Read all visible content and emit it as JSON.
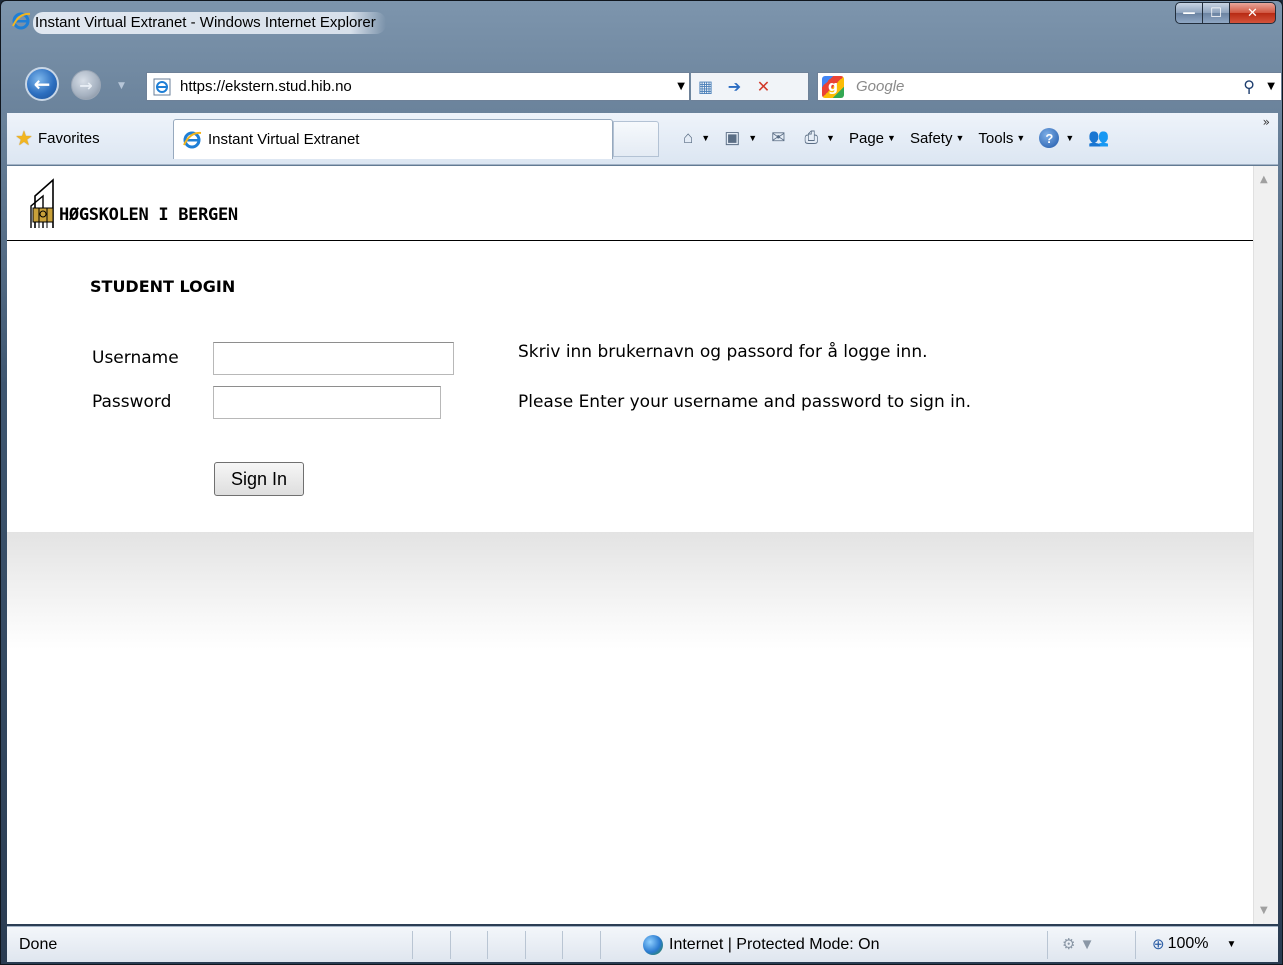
{
  "window": {
    "title": "Instant Virtual Extranet - Windows Internet Explorer",
    "controls": {
      "minimize": "—",
      "maximize": "☐",
      "close": "✕"
    }
  },
  "nav": {
    "back_glyph": "←",
    "forward_glyph": "→",
    "url": "https://ekstern.stud.hib.no",
    "search_placeholder": "Google",
    "search_logo_letter": "g"
  },
  "commandbar": {
    "favorites_label": "Favorites",
    "tab_label": "Instant Virtual Extranet",
    "page_label": "Page",
    "safety_label": "Safety",
    "tools_label": "Tools",
    "help_glyph": "?"
  },
  "page": {
    "logo_text": "HØGSKOLEN I BERGEN",
    "login_title": "STUDENT LOGIN",
    "username_label": "Username",
    "password_label": "Password",
    "username_value": "",
    "password_value": "",
    "msg_no": "Skriv inn brukernavn og passord for å logge inn.",
    "msg_en": "Please Enter your username and password to sign in.",
    "signin_label": "Sign In"
  },
  "status": {
    "text": "Done",
    "zone": "Internet | Protected Mode: On",
    "zoom": "100%"
  },
  "colors": {
    "frame": "#3e5670",
    "command_bar": "#dce6f2",
    "close_button": "#c0391f"
  },
  "icons": [
    "ie-icon",
    "back-icon",
    "forward-icon",
    "page-icon",
    "compat-icon",
    "go-icon",
    "stop-icon",
    "google-icon",
    "search-icon",
    "favorites-star-icon",
    "home-icon",
    "feeds-icon",
    "mail-icon",
    "print-icon",
    "help-icon",
    "research-icon",
    "globe-icon",
    "security-icon",
    "zoom-icon"
  ]
}
